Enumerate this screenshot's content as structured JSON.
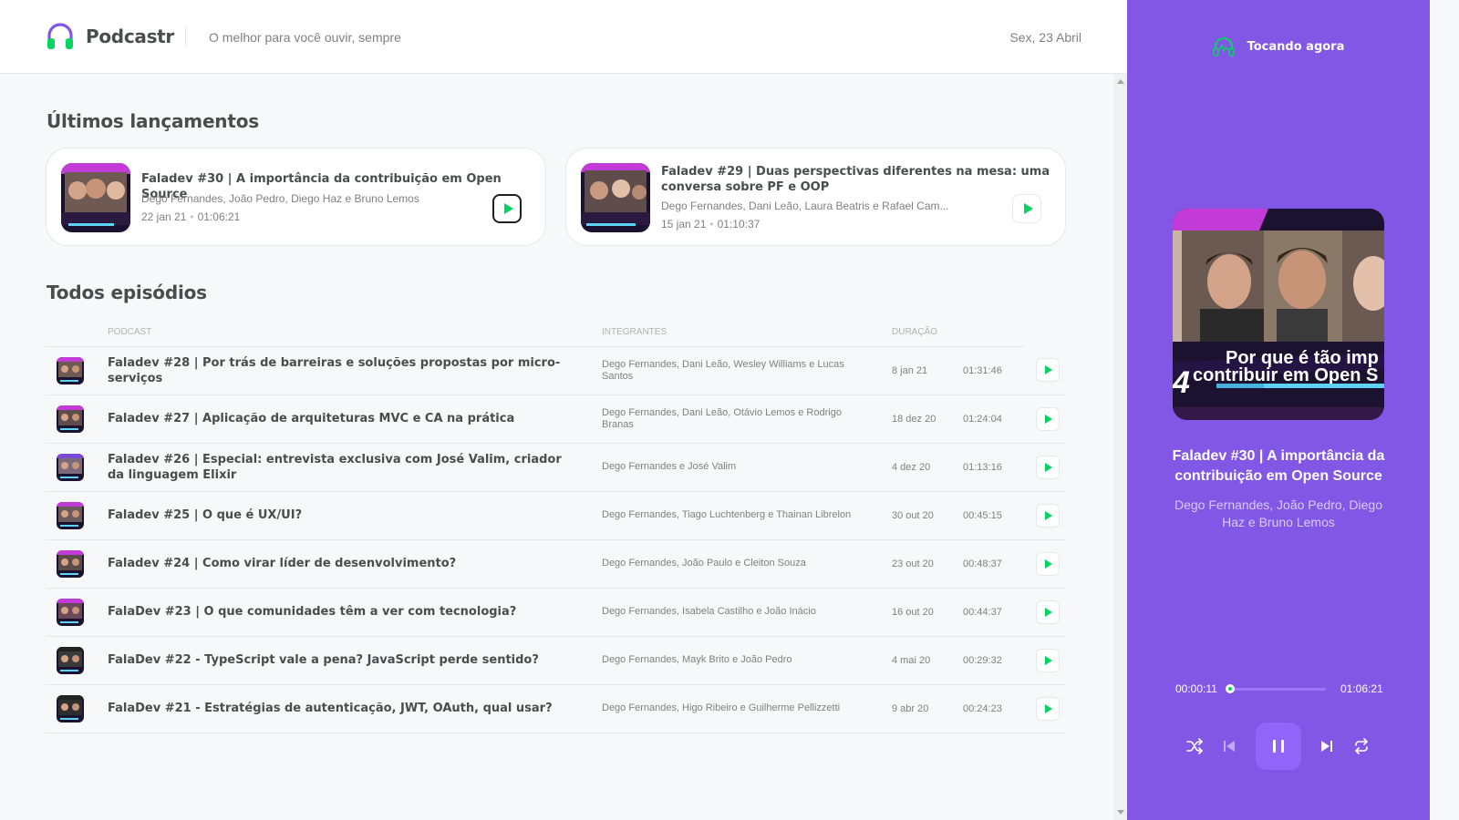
{
  "header": {
    "logo_text": "Podcastr",
    "tagline": "O melhor para você ouvir, sempre",
    "date": "Sex, 23 Abril"
  },
  "latest": {
    "heading": "Últimos lançamentos",
    "cards": [
      {
        "title": "Faladev #30 | A importância da contribuição em Open Source",
        "members": "Dego Fernandes, João Pedro, Diego Haz e Bruno Lemos",
        "date": "22 jan 21",
        "duration": "01:06:21"
      },
      {
        "title": "Faladev #29 | Duas perspectivas diferentes na mesa: uma conversa sobre PF e OOP",
        "members": "Dego Fernandes, Dani Leão, Laura Beatris e Rafael Cam...",
        "date": "15 jan 21",
        "duration": "01:10:37"
      }
    ]
  },
  "all": {
    "heading": "Todos episódios",
    "columns": {
      "podcast": "Podcast",
      "members": "Integrantes",
      "duration": "Duração"
    },
    "rows": [
      {
        "title": "Faladev #28 | Por trás de barreiras e soluções propostas por micro-serviços",
        "members": "Dego Fernandes, Dani Leão, Wesley Williams e Lucas Santos",
        "date": "8 jan 21",
        "duration": "01:31:46"
      },
      {
        "title": "Faladev #27 | Aplicação de arquiteturas MVC e CA na prática",
        "members": "Dego Fernandes, Dani Leão, Otávio Lemos e Rodrigo Branas",
        "date": "18 dez 20",
        "duration": "01:24:04"
      },
      {
        "title": "Faladev #26 | Especial: entrevista exclusiva com José Valim, criador da linguagem Elixir",
        "members": "Dego Fernandes e José Valim",
        "date": "4 dez 20",
        "duration": "01:13:16"
      },
      {
        "title": "Faladev #25 | O que é UX/UI?",
        "members": "Dego Fernandes, Tiago Luchtenberg e Thainan Librelon",
        "date": "30 out 20",
        "duration": "00:45:15"
      },
      {
        "title": "Faladev #24 | Como virar líder de desenvolvimento?",
        "members": "Dego Fernandes, João Paulo e Cleiton Souza",
        "date": "23 out 20",
        "duration": "00:48:37"
      },
      {
        "title": "FalaDev #23 | O que comunidades têm a ver com tecnologia?",
        "members": "Dego Fernandes, Isabela Castilho e João Inácio",
        "date": "16 out 20",
        "duration": "00:44:37"
      },
      {
        "title": "FalaDev #22 - TypeScript vale a pena? JavaScript perde sentido?",
        "members": "Dego Fernandes, Mayk Brito e João Pedro",
        "date": "4 mai 20",
        "duration": "00:29:32"
      },
      {
        "title": "FalaDev #21 - Estratégias de autenticação, JWT, OAuth, qual usar?",
        "members": "Dego Fernandes, Higo Ribeiro e Guilherme Pellizzetti",
        "date": "9 abr 20",
        "duration": "00:24:23"
      }
    ]
  },
  "player": {
    "heading": "Tocando agora",
    "title": "Faladev #30 | A importância da contribuição em Open Source",
    "members": "Dego Fernandes, João Pedro, Diego Haz e Bruno Lemos",
    "current_time": "00:00:11",
    "total_time": "01:06:21",
    "progress": 0.003,
    "cover_text_line1": "Por que é tão imp",
    "cover_text_line2": "contribuir em Open S",
    "cover_number": "4"
  },
  "colors": {
    "purple": "#8257e5",
    "green": "#04d361",
    "text": "#494d4b",
    "muted": "#808080"
  }
}
